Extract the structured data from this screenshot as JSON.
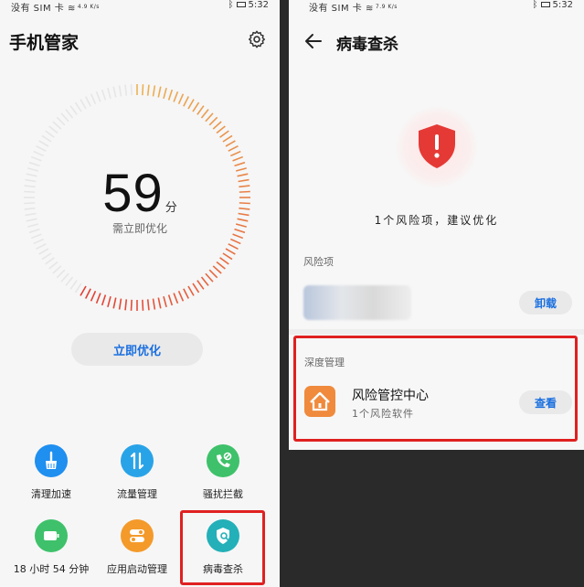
{
  "status_bar": {
    "carrier": "没有 SIM 卡",
    "speed": "4.9 K/s",
    "speed_right": "7.9 K/s",
    "time": "5:32"
  },
  "left_screen": {
    "title": "手机管家",
    "score": {
      "value": 59,
      "unit": "分",
      "subtitle": "需立即优化"
    },
    "optimize_label": "立即优化",
    "tiles": [
      {
        "label": "清理加速",
        "icon": "broom-icon",
        "color": "#1f8ff0"
      },
      {
        "label": "流量管理",
        "icon": "data-transfer-icon",
        "color": "#29a3e8"
      },
      {
        "label": "骚扰拦截",
        "icon": "call-block-icon",
        "color": "#3ec16a"
      },
      {
        "label": "18 小时 54 分钟",
        "icon": "battery-icon",
        "color": "#3ec16a"
      },
      {
        "label": "应用启动管理",
        "icon": "toggle-icon",
        "color": "#f49a2a"
      },
      {
        "label": "病毒查杀",
        "icon": "virus-scan-icon",
        "color": "#23b0b8"
      }
    ]
  },
  "right_screen": {
    "title": "病毒查杀",
    "summary": "1个风险项，建议优化",
    "risk_section": "风险项",
    "uninstall_label": "卸载",
    "deep_section": "深度管理",
    "app": {
      "name": "风险管控中心",
      "subtitle": "1个风险软件"
    },
    "view_label": "查看"
  },
  "colors": {
    "accent": "#1a6fe0",
    "warning": "#e02020",
    "shield": "#e53935"
  }
}
